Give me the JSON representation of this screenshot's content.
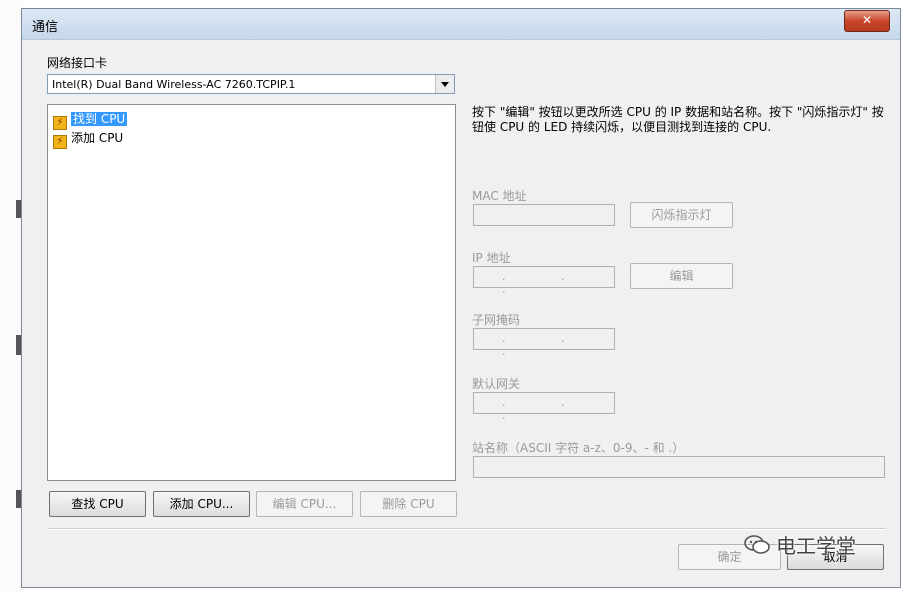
{
  "dialog": {
    "title": "通信",
    "close_icon": "close-icon"
  },
  "network": {
    "label": "网络接口卡",
    "selected": "Intel(R) Dual Band Wireless-AC 7260.TCPIP.1"
  },
  "tree": {
    "items": [
      {
        "label": "找到 CPU",
        "icon": "cpu-folder-icon",
        "selected": true
      },
      {
        "label": "添加 CPU",
        "icon": "cpu-folder-icon",
        "selected": false
      }
    ]
  },
  "buttons": {
    "find_cpu": "查找 CPU",
    "add_cpu": "添加 CPU...",
    "edit_cpu": "编辑 CPU...",
    "delete_cpu": "删除 CPU",
    "blink": "闪烁指示灯",
    "edit": "编辑",
    "ok": "确定",
    "cancel": "取消"
  },
  "info": {
    "text": "按下 \"编辑\" 按钮以更改所选 CPU 的 IP 数据和站名称。按下 \"闪烁指示灯\" 按钮使 CPU 的 LED 持续闪烁，以便目测找到连接的 CPU."
  },
  "fields": {
    "mac_label": "MAC 地址",
    "ip_label": "IP 地址",
    "subnet_label": "子网掩码",
    "gateway_label": "默认网关",
    "station_label": "站名称（ASCII 字符 a-z、0-9、- 和 .）",
    "ip_placeholder": ". . ."
  },
  "watermark": {
    "text": "电工学堂",
    "icon": "wechat-icon"
  }
}
